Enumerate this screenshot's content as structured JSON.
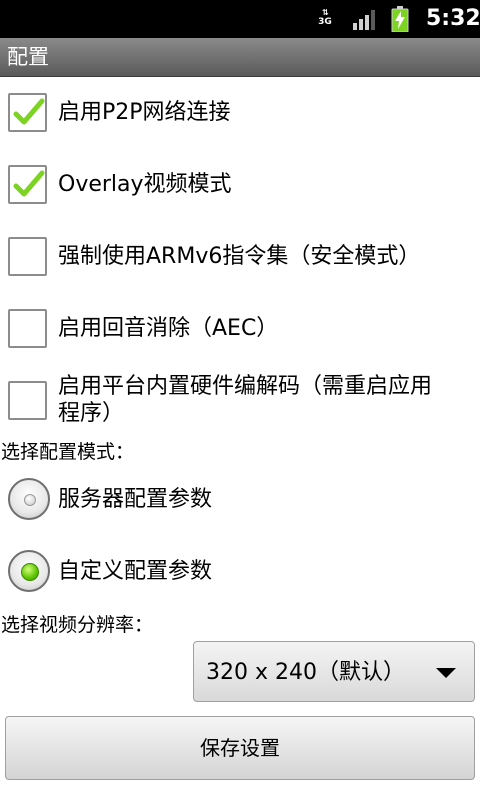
{
  "status_bar": {
    "network": "3G",
    "network_arrows": "⇅",
    "signal_icon": "signal-bars-icon",
    "battery_icon": "battery-charging-icon",
    "time": "5:32"
  },
  "title_bar": {
    "title": "配置"
  },
  "checkboxes": [
    {
      "label": "启用P2P网络连接",
      "checked": true
    },
    {
      "label": "Overlay视频模式",
      "checked": true
    },
    {
      "label": "强制使用ARMv6指令集（安全模式）",
      "checked": false
    },
    {
      "label": "启用回音消除（AEC）",
      "checked": false
    },
    {
      "label_line1": "启用平台内置硬件编解码（需重启应用",
      "label_line2": "程序）",
      "checked": false
    }
  ],
  "config_mode": {
    "label": "选择配置模式：",
    "options": [
      {
        "label": "服务器配置参数",
        "selected": false
      },
      {
        "label": "自定义配置参数",
        "selected": true
      }
    ]
  },
  "resolution": {
    "label": "选择视频分辨率：",
    "selected": "320 x 240（默认）"
  },
  "save_button": {
    "label": "保存设置"
  },
  "colors": {
    "checkmark": "#7dd321",
    "radio_selected": "#5cc400",
    "title_bar": "#6e6e6e"
  }
}
